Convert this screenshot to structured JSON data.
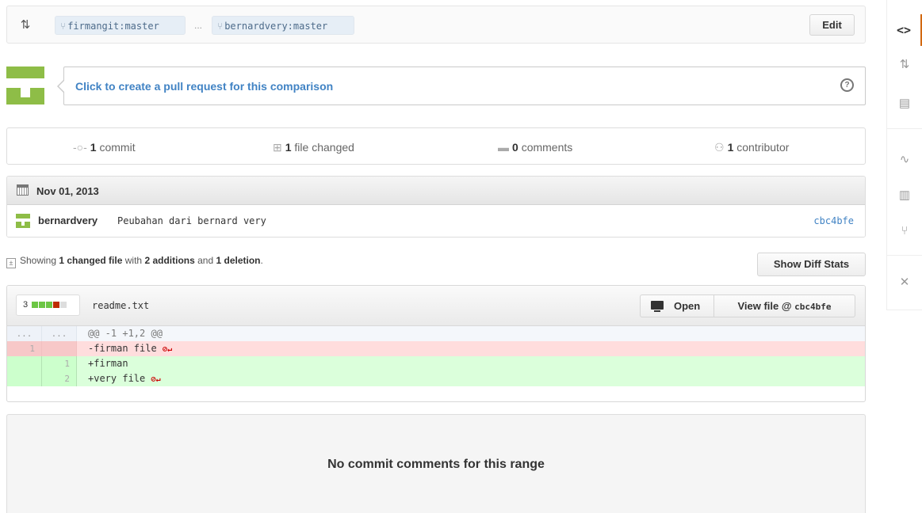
{
  "range": {
    "base_branch": "firmangit:master",
    "separator": "...",
    "head_branch": "bernardvery:master",
    "edit_label": "Edit"
  },
  "pull_request": {
    "prompt": "Click to create a pull request for this comparison",
    "help_glyph": "?"
  },
  "summary": {
    "commits_count": "1",
    "commits_label": "commit",
    "files_count": "1",
    "files_label": "file changed",
    "comments_count": "0",
    "comments_label": "comments",
    "contributors_count": "1",
    "contributors_label": "contributor"
  },
  "commit_group": {
    "date": "Nov 01, 2013",
    "commits": [
      {
        "author": "bernardvery",
        "message": "Peubahan dari bernard very",
        "sha": "cbc4bfe"
      }
    ]
  },
  "diff_stats": {
    "prefix": "Showing",
    "changed": "1 changed file",
    "with": "with",
    "additions": "2 additions",
    "and": "and",
    "deletions": "1 deletion",
    "suffix": ".",
    "show_button": "Show Diff Stats"
  },
  "file": {
    "change_count": "3",
    "name": "readme.txt",
    "open_label": "Open",
    "view_label": "View file @",
    "view_sha": "cbc4bfe",
    "hunk": {
      "old": "...",
      "new": "...",
      "text": "@@ -1 +1,2 @@"
    },
    "lines": [
      {
        "old": "1",
        "new": "",
        "text": "-firman file",
        "type": "del"
      },
      {
        "old": "",
        "new": "1",
        "text": "+firman",
        "type": "ins"
      },
      {
        "old": "",
        "new": "2",
        "text": "+very file",
        "type": "ins"
      }
    ],
    "eol_marker": "⊘↵"
  },
  "comments": {
    "empty_text": "No commit comments for this range"
  },
  "sidebar": {
    "items": [
      {
        "icon": "code-icon",
        "glyph": "<>"
      },
      {
        "icon": "pull-request-icon",
        "glyph": "⇅"
      },
      {
        "icon": "wiki-icon",
        "glyph": "▤"
      },
      {
        "icon": "pulse-icon",
        "glyph": "∿"
      },
      {
        "icon": "graphs-icon",
        "glyph": "▥"
      },
      {
        "icon": "network-icon",
        "glyph": "⑂"
      },
      {
        "icon": "settings-icon",
        "glyph": "✕"
      }
    ]
  },
  "colors": {
    "link": "#4183c4",
    "addition": "#6cc644",
    "deletion": "#bd2c00",
    "accent": "#d26911"
  }
}
